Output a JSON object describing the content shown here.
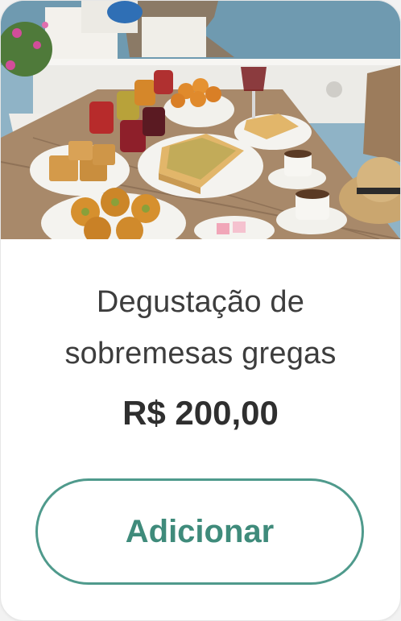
{
  "product": {
    "image_alt_icon": "product-photo",
    "title_line1": "Degustação de",
    "title_line2": "sobremesas gregas",
    "price": "R$ 200,00",
    "add_label": "Adicionar"
  },
  "colors": {
    "accent": "#4f9a8c",
    "text": "#3d3d3d"
  }
}
